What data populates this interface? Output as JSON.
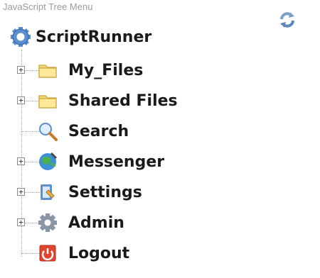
{
  "caption": "JavaScript Tree Menu",
  "root": {
    "label": "ScriptRunner",
    "icon": "gear-icon"
  },
  "refresh_icon": "refresh-icon",
  "items": [
    {
      "label": "My_Files",
      "icon": "folder-icon",
      "expandable": true
    },
    {
      "label": "Shared Files",
      "icon": "folder-icon",
      "expandable": true
    },
    {
      "label": "Search",
      "icon": "magnifier-icon",
      "expandable": false
    },
    {
      "label": "Messenger",
      "icon": "globe-icon",
      "expandable": true
    },
    {
      "label": "Settings",
      "icon": "settings-icon",
      "expandable": true
    },
    {
      "label": "Admin",
      "icon": "gear-icon",
      "expandable": true
    },
    {
      "label": "Logout",
      "icon": "power-icon",
      "expandable": false
    }
  ],
  "expander_glyph": "+"
}
